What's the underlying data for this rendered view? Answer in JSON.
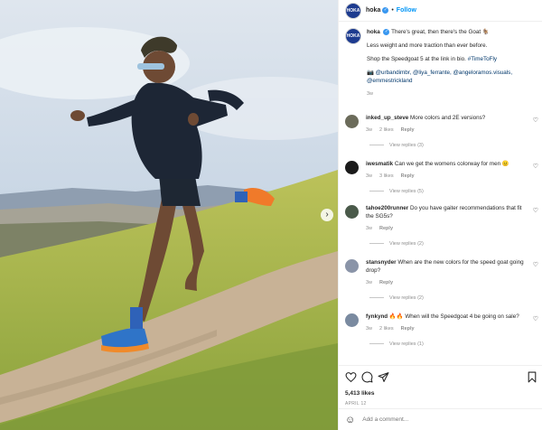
{
  "post": {
    "username": "hoka",
    "follow_label": "Follow",
    "avatar_text": "HOKA"
  },
  "caption": {
    "username": "hoka",
    "line1": "There's great, then there's the Goat 🐐",
    "line2": "Less weight and more traction than ever before.",
    "line3_prefix": "Shop the Speedgoat 5 at the link in bio. ",
    "line3_hashtag": "#TimeToFly",
    "credits": "📷 @urbandimbr, @liya_ferrante, @angeloramos.visuals, @emmestrickland",
    "age": "3w"
  },
  "comments": [
    {
      "username": "inked_up_steve",
      "text": "More colors and 2E versions?",
      "age": "3w",
      "likes": "2 likes",
      "reply": "Reply",
      "view_replies": "View replies (3)",
      "avatar_color": "#6b6b5a"
    },
    {
      "username": "iwesmatik",
      "text": "Can we get the womens colorway for men 😐",
      "age": "3w",
      "likes": "3 likes",
      "reply": "Reply",
      "view_replies": "View replies (5)",
      "avatar_color": "#1a1a1a"
    },
    {
      "username": "tahoe200runner",
      "text": "Do you have gaiter recommendations that fit the SG5s?",
      "age": "3w",
      "likes": "",
      "reply": "Reply",
      "view_replies": "View replies (2)",
      "avatar_color": "#4a5a4a"
    },
    {
      "username": "stansnyder",
      "text": "When are the new colors for the speed goat going drop?",
      "age": "3w",
      "likes": "",
      "reply": "Reply",
      "view_replies": "View replies (2)",
      "avatar_color": "#8a94a8"
    },
    {
      "username": "fynkynd",
      "text": "🔥🔥 When will the Speedgoat 4 be going on sale?",
      "age": "3w",
      "likes": "2 likes",
      "reply": "Reply",
      "view_replies": "View replies (1)",
      "avatar_color": "#7a8aa0"
    }
  ],
  "footer": {
    "likes": "5,413 likes",
    "date": "APRIL 12",
    "add_comment_placeholder": "Add a comment..."
  },
  "icons": {
    "like": "heart-icon",
    "comment": "comment-icon",
    "share": "share-icon",
    "save": "bookmark-icon",
    "emoji": "emoji-icon",
    "next": "chevron-right-icon"
  },
  "colors": {
    "link": "#00376b",
    "follow": "#0095f6",
    "muted": "#8e8e8e"
  }
}
